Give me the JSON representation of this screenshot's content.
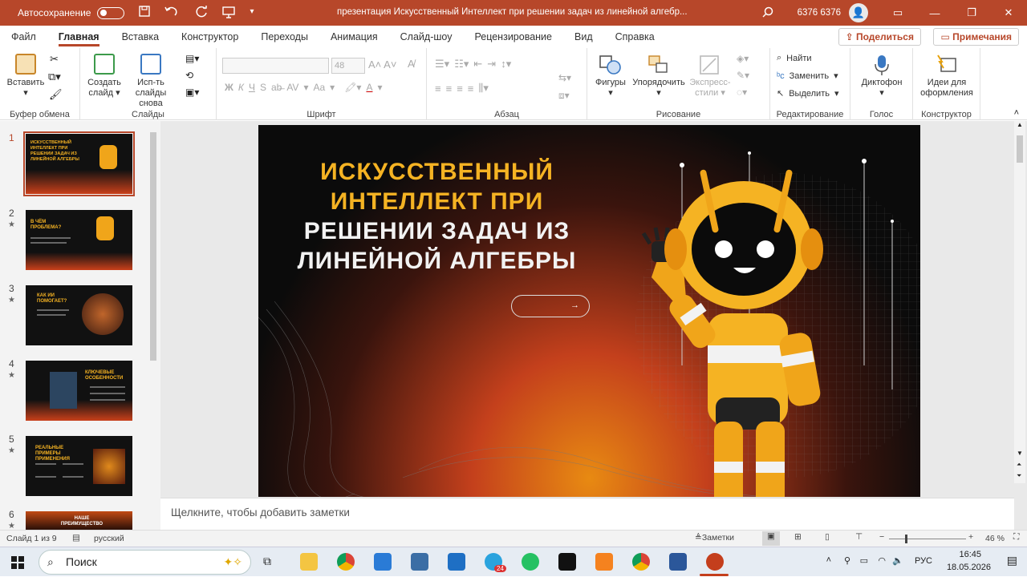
{
  "titlebar": {
    "autosave_label": "Автосохранение",
    "doc_title": "презентация Искусственный Интеллект при решении задач из линейной алгебр...",
    "user": "6376 6376",
    "icons": [
      "save-icon",
      "undo-icon",
      "redo-icon",
      "present-icon",
      "customize-icon",
      "search-icon",
      "ribbon-display-icon",
      "minimize-icon",
      "restore-icon",
      "close-icon"
    ]
  },
  "menu": {
    "items": [
      "Файл",
      "Главная",
      "Вставка",
      "Конструктор",
      "Переходы",
      "Анимация",
      "Слайд-шоу",
      "Рецензирование",
      "Вид",
      "Справка"
    ],
    "active": "Главная",
    "share": "Поделиться",
    "comments": "Примечания"
  },
  "ribbon": {
    "clipboard": {
      "label": "Буфер обмена",
      "paste": "Вставить"
    },
    "slides": {
      "label": "Слайды",
      "new_slide": "Создать слайд",
      "reuse": "Исп-ть слайды снова"
    },
    "font": {
      "label": "Шрифт",
      "size": "48",
      "format_buttons": [
        "Ж",
        "К",
        "Ч",
        "S",
        "AV",
        "Aa"
      ]
    },
    "paragraph": {
      "label": "Абзац"
    },
    "drawing": {
      "label": "Рисование",
      "shapes": "Фигуры",
      "arrange": "Упорядочить",
      "styles": "Экспресс-стили"
    },
    "editing": {
      "label": "Редактирование",
      "find": "Найти",
      "replace": "Заменить",
      "select": "Выделить"
    },
    "voice": {
      "label": "Голос",
      "dictate": "Диктофон"
    },
    "designer": {
      "label": "Конструктор",
      "ideas": "Идеи для оформления"
    }
  },
  "thumbnails": [
    {
      "num": "1",
      "title": "ИСКУССТВЕННЫЙ ИНТЕЛЛЕКТ ПРИ РЕШЕНИИ ЗАДАЧ ИЗ ЛИНЕЙНОЙ АЛГЕБРЫ",
      "star": ""
    },
    {
      "num": "2",
      "title": "В ЧЁМ ПРОБЛЕМА?",
      "star": "★"
    },
    {
      "num": "3",
      "title": "КАК ИИ ПОМОГАЕТ?",
      "star": "★"
    },
    {
      "num": "4",
      "title": "КЛЮЧЕВЫЕ ОСОБЕННОСТИ",
      "star": "★"
    },
    {
      "num": "5",
      "title": "РЕАЛЬНЫЕ ПРИМЕРЫ ПРИМЕНЕНИЯ",
      "star": "★"
    },
    {
      "num": "6",
      "title": "НАШЕ ПРЕИМУЩЕСТВО",
      "star": "★"
    }
  ],
  "slide": {
    "title_line1": "ИСКУССТВЕННЫЙ",
    "title_line2": "ИНТЕЛЛЕКТ ПРИ",
    "title_line3": "РЕШЕНИИ ЗАДАЧ ИЗ",
    "title_line4": "ЛИНЕЙНОЙ АЛГЕБРЫ",
    "button_arrow": "→"
  },
  "notes_placeholder": "Щелкните, чтобы добавить заметки",
  "status": {
    "slide_info": "Слайд 1 из 9",
    "language": "русский",
    "notes": "Заметки",
    "zoom": "46 %"
  },
  "taskbar": {
    "search_placeholder": "Поиск",
    "language": "РУС",
    "time": "16:45",
    "date": "18.05.2026",
    "telegram_badge": "24"
  },
  "colors": {
    "accent": "#b7472a",
    "slide_yellow": "#f5b323"
  }
}
